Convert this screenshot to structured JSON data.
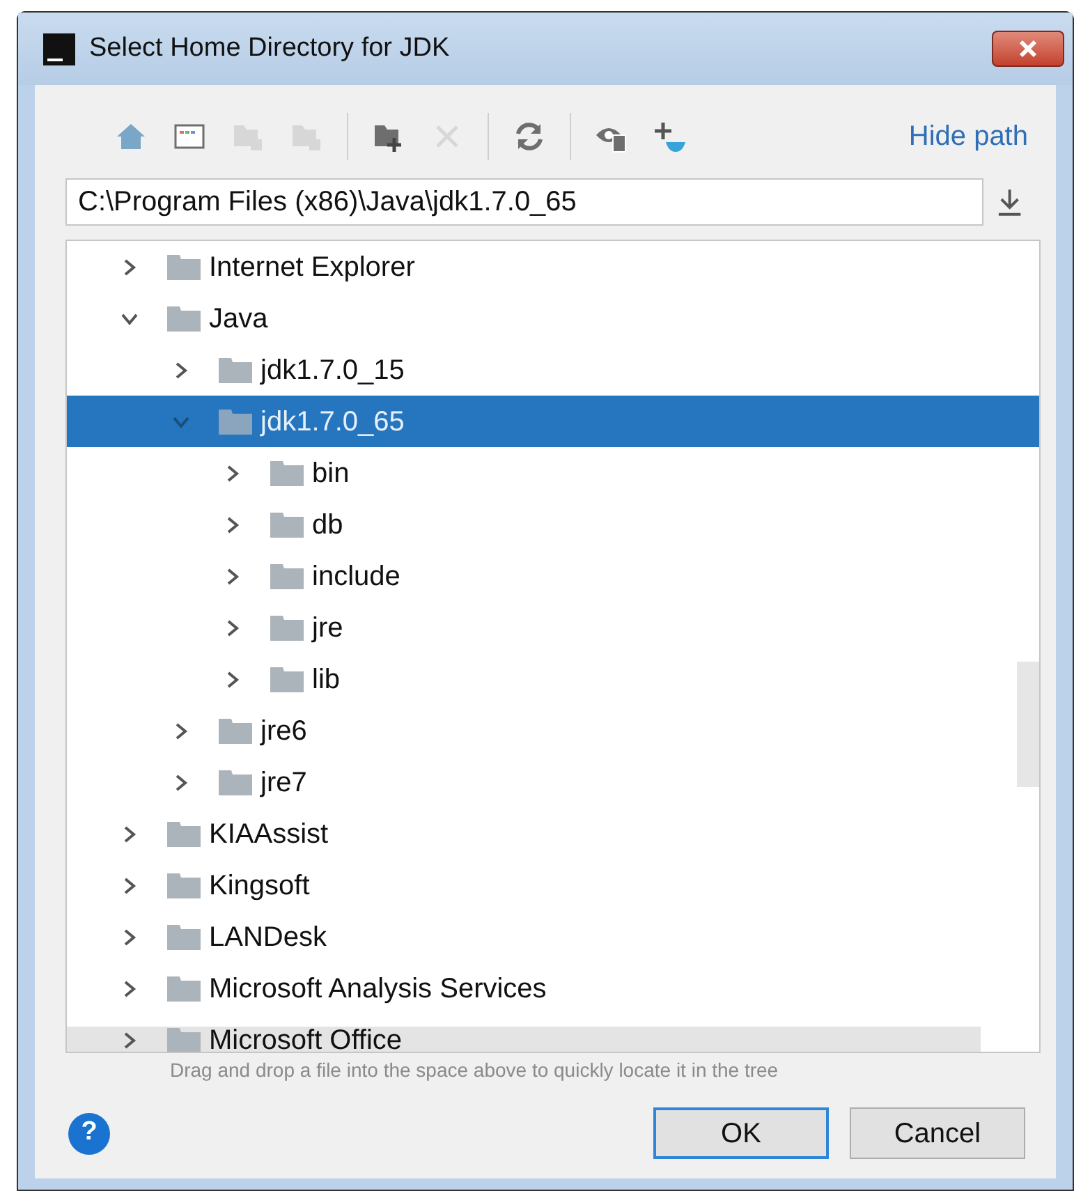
{
  "window": {
    "title": "Select Home Directory for JDK"
  },
  "toolbar": [
    {
      "kind": "home",
      "disabled": false
    },
    {
      "kind": "desktop",
      "disabled": false
    },
    {
      "kind": "project",
      "disabled": true
    },
    {
      "kind": "module",
      "disabled": true
    },
    {
      "kind": "separator"
    },
    {
      "kind": "new-folder",
      "disabled": false
    },
    {
      "kind": "delete",
      "disabled": true
    },
    {
      "kind": "separator"
    },
    {
      "kind": "refresh",
      "disabled": false
    },
    {
      "kind": "separator"
    },
    {
      "kind": "show-hidden",
      "disabled": false
    },
    {
      "kind": "add-jdk",
      "disabled": false
    }
  ],
  "hide_path_link": "Hide path",
  "path_field": {
    "value": "C:\\Program Files (x86)\\Java\\jdk1.7.0_65"
  },
  "tree": [
    {
      "name": "Internet Explorer",
      "expanded": false,
      "selected": false
    },
    {
      "name": "Java",
      "expanded": true,
      "selected": false,
      "children": [
        {
          "name": "jdk1.7.0_15",
          "expanded": false,
          "selected": false
        },
        {
          "name": "jdk1.7.0_65",
          "expanded": true,
          "selected": true,
          "children": [
            {
              "name": "bin",
              "expanded": false,
              "selected": false
            },
            {
              "name": "db",
              "expanded": false,
              "selected": false
            },
            {
              "name": "include",
              "expanded": false,
              "selected": false
            },
            {
              "name": "jre",
              "expanded": false,
              "selected": false
            },
            {
              "name": "lib",
              "expanded": false,
              "selected": false
            }
          ]
        },
        {
          "name": "jre6",
          "expanded": false,
          "selected": false
        },
        {
          "name": "jre7",
          "expanded": false,
          "selected": false
        }
      ]
    },
    {
      "name": "KIAAssist",
      "expanded": false,
      "selected": false
    },
    {
      "name": "Kingsoft",
      "expanded": false,
      "selected": false
    },
    {
      "name": "LANDesk",
      "expanded": false,
      "selected": false
    },
    {
      "name": "Microsoft Analysis Services",
      "expanded": false,
      "selected": false
    },
    {
      "name": "Microsoft Office",
      "expanded": false,
      "selected": false
    }
  ],
  "hint": "Drag and drop a file into the space above to quickly locate it in the tree",
  "help_button": "?",
  "buttons": [
    {
      "label": "OK",
      "selected": true
    },
    {
      "label": "Cancel",
      "selected": false
    }
  ]
}
